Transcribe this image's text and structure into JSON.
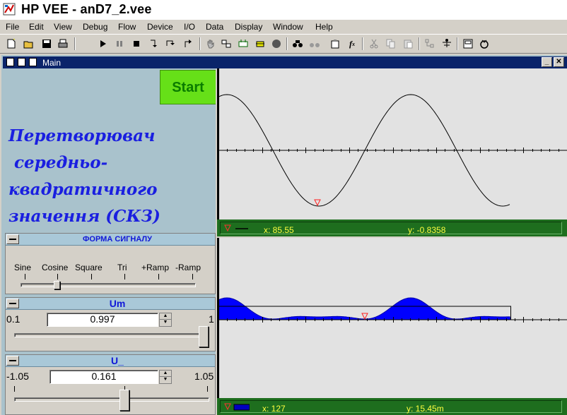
{
  "app": {
    "title": "HP VEE - anD7_2.vee"
  },
  "menu": [
    "File",
    "Edit",
    "View",
    "Debug",
    "Flow",
    "Device",
    "I/O",
    "Data",
    "Display",
    "Window",
    "Help"
  ],
  "toolbar": {
    "icons": [
      "new-icon",
      "open-icon",
      "save-icon",
      "print-icon",
      "run-icon",
      "pause-icon",
      "stop-icon",
      "step-into-icon",
      "step-over-icon",
      "step-out-icon",
      "hand-icon",
      "show-data-flow-icon",
      "show-execution-flow-icon",
      "line-probe-icon",
      "breakpoint-icon",
      "find-icon",
      "find-next-icon",
      "properties-icon",
      "function-icon",
      "cut-icon",
      "copy-icon",
      "paste-icon",
      "create-user-object-icon",
      "tree-icon",
      "panel-view-icon",
      "settings-icon"
    ]
  },
  "main_window": {
    "title": "Main"
  },
  "start_button": {
    "label": "Start"
  },
  "title_block": {
    "lines": [
      "Перетворювач",
      " середньо-",
      "квадратичного",
      "значення (СКЗ)"
    ]
  },
  "waveform_panel": {
    "title": "ФОРМА СИГНАЛУ",
    "options": [
      "Sine",
      "Cosine",
      "Square",
      "Tri",
      "+Ramp",
      "-Ramp"
    ],
    "selected": "Cosine"
  },
  "um_panel": {
    "title": "Um",
    "min": "0.1",
    "max": "1",
    "value": "0.997"
  },
  "u_panel": {
    "title": "U_",
    "min": "-1.05",
    "max": "1.05",
    "value": "0.161"
  },
  "graph_top": {
    "marker_x": "x: 85.55",
    "marker_y": "y: -0.8358"
  },
  "graph_bottom": {
    "marker_x": "x: 127",
    "marker_y": "y: 15.45m"
  },
  "colors": {
    "accent": "#0a246a",
    "graph_fill": "#0000ff",
    "start": "#66e018",
    "readout": "#1e6e1e",
    "readout_text": "#ffff40",
    "title_text": "#1a1fe0"
  },
  "chart_data": [
    {
      "type": "line",
      "series": [
        {
          "values_shape": "cosine"
        }
      ],
      "x": [
        0,
        25,
        50,
        75,
        100,
        125,
        150,
        175,
        200
      ],
      "y": [
        0.89,
        0.42,
        -0.41,
        -0.84,
        -0.4,
        0.42,
        0.89,
        0.42,
        -0.4
      ]
    },
    {
      "type": "area",
      "series": [
        {
          "values_shape": "rectified"
        }
      ],
      "x": [
        0,
        25,
        50,
        75,
        100,
        125,
        150,
        175,
        200
      ],
      "y": [
        0.5,
        0.35,
        0.15,
        0.3,
        0.02,
        0.35,
        0.55,
        0.3,
        0.12
      ]
    }
  ]
}
